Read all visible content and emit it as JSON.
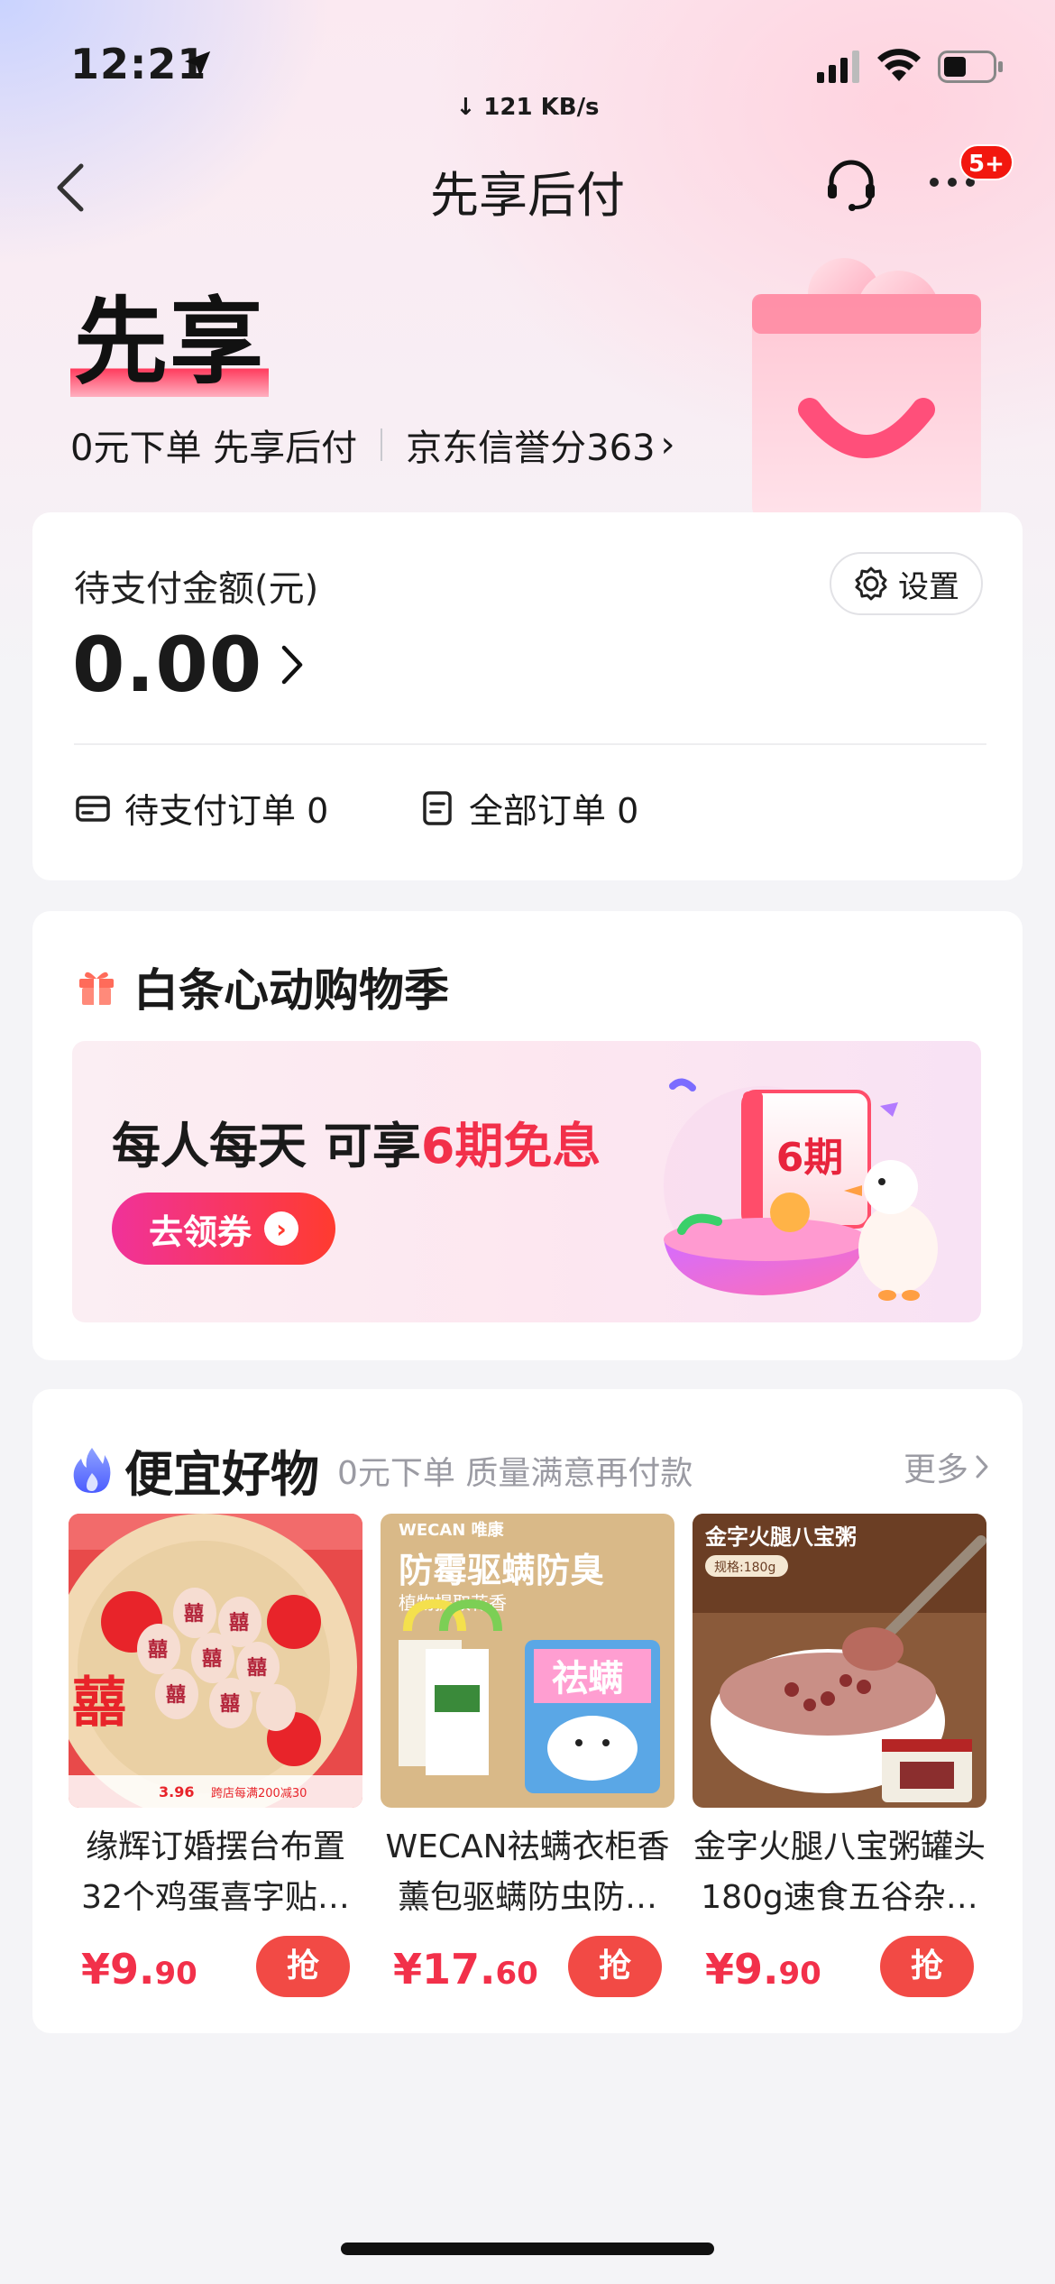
{
  "status_bar": {
    "time": "12:21",
    "net_speed": "↓ 121 KB/s"
  },
  "nav": {
    "title": "先享后付",
    "badge": "5+"
  },
  "hero": {
    "title": "先享",
    "tagline": "0元下单 先享后付",
    "credit_score": "京东信誉分363"
  },
  "pending_card": {
    "label": "待支付金额(元)",
    "settings_label": "设置",
    "amount": "0.00",
    "pending_orders": "待支付订单 0",
    "all_orders": "全部订单 0"
  },
  "promo": {
    "title": "白条心动购物季",
    "banner_text_a": "每人每天 可享",
    "banner_text_b": "6期免息",
    "art_label": "6期",
    "coupon_button": "去领券"
  },
  "goods": {
    "title": "便宜好物",
    "subtitle": "0元下单 质量满意再付款",
    "more": "更多",
    "products": [
      {
        "line1": "缘辉订婚摆台布置",
        "line2": "32个鸡蛋喜字贴…",
        "price_int": "¥9.",
        "price_dec": "90",
        "button": "抢",
        "img_price": "3.96",
        "img_promo": "跨店每满200减30"
      },
      {
        "line1": "WECAN祛螨衣柜香",
        "line2": "薰包驱螨防虫防…",
        "price_int": "¥17.",
        "price_dec": "60",
        "button": "抢",
        "img_brand": "WECAN 唯康",
        "img_title": "防霉驱螨防臭",
        "img_sub": "植物提取花香",
        "img_pack": "祛螨"
      },
      {
        "line1": "金字火腿八宝粥罐头",
        "line2": "180g速食五谷杂…",
        "price_int": "¥9.",
        "price_dec": "90",
        "button": "抢",
        "img_title": "金字火腿八宝粥",
        "img_spec": "规格:180g"
      }
    ]
  },
  "colors": {
    "accent_red": "#f2304a",
    "badge_red": "#f2170e",
    "grab_red": "#f24a45"
  }
}
